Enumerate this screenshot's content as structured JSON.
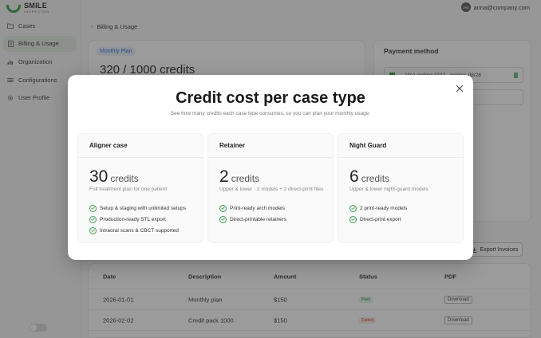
{
  "brand": {
    "name": "SMILE",
    "sub": "INSPECTOR"
  },
  "user": {
    "initials": "AM",
    "email": "anna@company.com"
  },
  "sidebar": {
    "items": [
      {
        "label": "Cases",
        "icon": "folder-icon"
      },
      {
        "label": "Billing & Usage",
        "icon": "document-icon",
        "active": true
      },
      {
        "label": "Organization",
        "icon": "bar-chart-icon"
      },
      {
        "label": "Configurations",
        "icon": "sliders-icon"
      },
      {
        "label": "User Profile",
        "icon": "gear-icon"
      }
    ]
  },
  "breadcrumb": {
    "label": "Billing & Usage"
  },
  "plan": {
    "badge": "Monthly Plan",
    "credits": "320 / 1000 credits"
  },
  "payment": {
    "title": "Payment method",
    "card_text": "Visa ending 4242 · expires 08/28"
  },
  "invoices": {
    "export_label": "Export Invoices",
    "columns": [
      "Date",
      "Description",
      "Amount",
      "Status",
      "PDF"
    ],
    "rows": [
      {
        "date": "2026-01-01",
        "description": "Monthly plan",
        "amount": "$150",
        "status": "Paid",
        "pdf": "Download"
      },
      {
        "date": "2026-02-02",
        "description": "Credit pack 1000",
        "amount": "$150",
        "status": "Failed",
        "pdf": "Download"
      }
    ]
  },
  "modal": {
    "title": "Credit cost per case type",
    "subtitle": "See how many credits each case type consumes, so you can plan your monthly usage.",
    "tiers": [
      {
        "name": "Aligner case",
        "amount": "30",
        "unit": "credits",
        "description": "Full treatment plan for one patient",
        "features": [
          "Setup & staging with unlimited setups",
          "Production-ready STL export",
          "Intraoral scans & CBCT supported"
        ]
      },
      {
        "name": "Retainer",
        "amount": "2",
        "unit": "credits",
        "description": "Upper & lower · 2 models + 2 direct-print files",
        "features": [
          "Print-ready arch models",
          "Direct-printable retainers"
        ]
      },
      {
        "name": "Night Guard",
        "amount": "6",
        "unit": "credits",
        "description": "Upper & lower night-guard models",
        "features": [
          "2 print-ready models",
          "Direct-print export"
        ]
      }
    ]
  },
  "colors": {
    "accent": "#2e9e4a",
    "overlay": "#2d2d2d",
    "paid": "#2e8f46",
    "failed": "#d23b3b"
  }
}
